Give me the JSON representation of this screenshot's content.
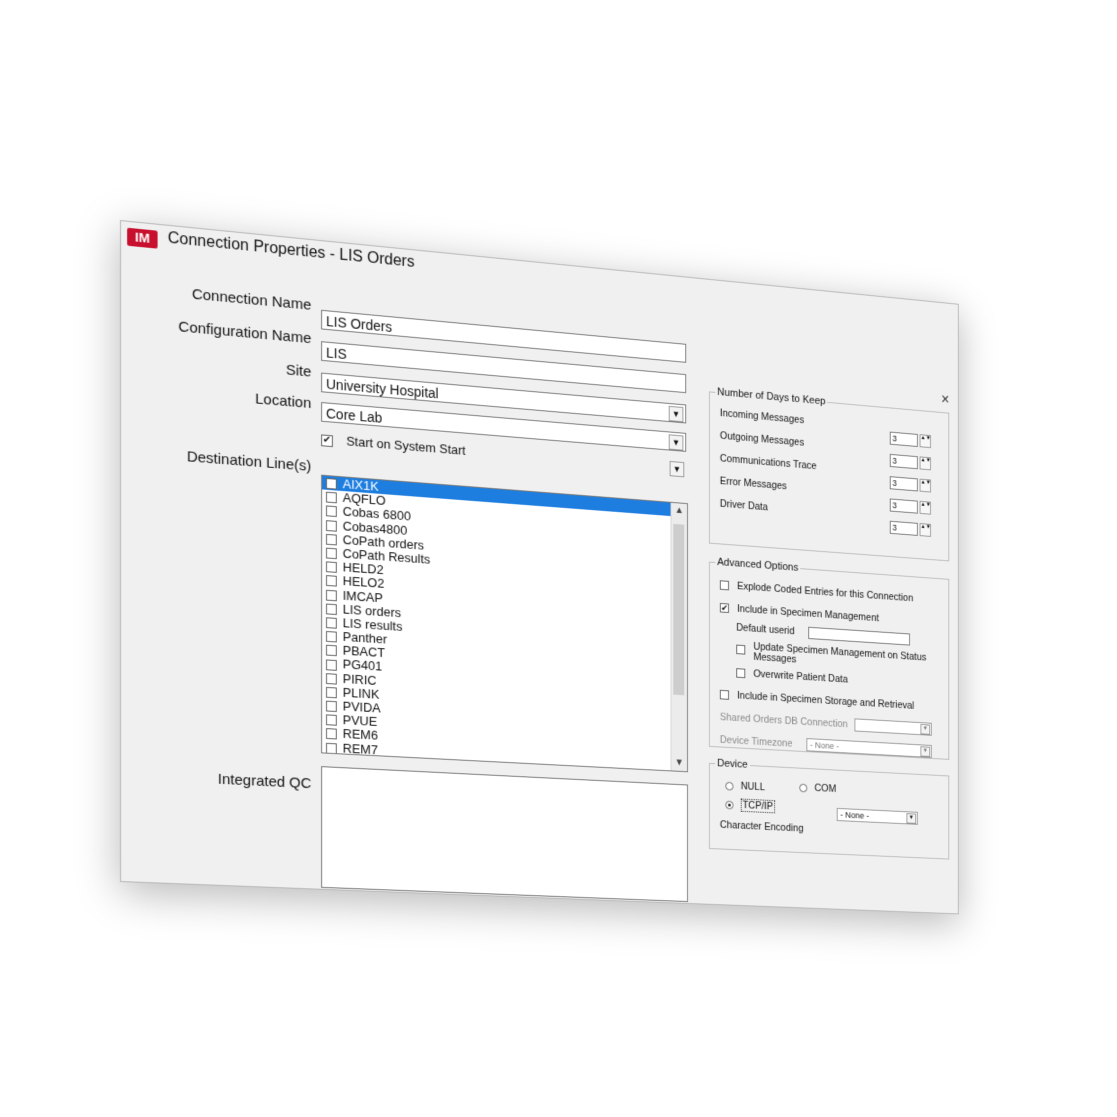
{
  "window": {
    "logo_text": "IM",
    "title": "Connection Properties - LIS Orders",
    "close_glyph": "×"
  },
  "form": {
    "connection_name_label": "Connection Name",
    "connection_name_value": "LIS Orders",
    "configuration_name_label": "Configuration Name",
    "configuration_name_value": "LIS",
    "site_label": "Site",
    "site_value": "University Hospital",
    "location_label": "Location",
    "location_value": "Core Lab",
    "start_on_system_start_label": "Start on System Start",
    "start_on_system_start_checked": true,
    "destination_lines_label": "Destination Line(s)",
    "destination_lines": [
      {
        "label": "AIX1K",
        "selected": true
      },
      {
        "label": "AQFLO",
        "selected": false
      },
      {
        "label": "Cobas 6800",
        "selected": false
      },
      {
        "label": "Cobas4800",
        "selected": false
      },
      {
        "label": "CoPath orders",
        "selected": false
      },
      {
        "label": "CoPath Results",
        "selected": false
      },
      {
        "label": "HELD2",
        "selected": false
      },
      {
        "label": "HELO2",
        "selected": false
      },
      {
        "label": "IMCAP",
        "selected": false
      },
      {
        "label": "LIS orders",
        "selected": false
      },
      {
        "label": "LIS results",
        "selected": false
      },
      {
        "label": "Panther",
        "selected": false
      },
      {
        "label": "PBACT",
        "selected": false
      },
      {
        "label": "PG401",
        "selected": false
      },
      {
        "label": "PIRIC",
        "selected": false
      },
      {
        "label": "PLINK",
        "selected": false
      },
      {
        "label": "PVIDA",
        "selected": false
      },
      {
        "label": "PVUE",
        "selected": false
      },
      {
        "label": "REM6",
        "selected": false
      },
      {
        "label": "REM7",
        "selected": false
      }
    ],
    "integrated_qc_label": "Integrated QC"
  },
  "days_to_keep": {
    "legend": "Number of Days to Keep",
    "rows": [
      {
        "label": "Incoming Messages",
        "value": "3"
      },
      {
        "label": "Outgoing Messages",
        "value": "3"
      },
      {
        "label": "Communications Trace",
        "value": "3"
      },
      {
        "label": "Error Messages",
        "value": "3"
      },
      {
        "label": "Driver Data",
        "value": "3"
      }
    ]
  },
  "advanced": {
    "legend": "Advanced Options",
    "explode_coded_label": "Explode Coded Entries for this Connection",
    "explode_coded_checked": false,
    "include_specimen_mgmt_label": "Include in Specimen Management",
    "include_specimen_mgmt_checked": true,
    "default_userid_label": "Default userid",
    "default_userid_value": "",
    "update_specimen_line1": "Update Specimen Management on Status",
    "update_specimen_line2": "Messages",
    "update_specimen_checked": false,
    "overwrite_patient_label": "Overwrite Patient Data",
    "overwrite_patient_checked": false,
    "include_storage_label": "Include in Specimen Storage and Retrieval",
    "include_storage_checked": false,
    "shared_orders_label": "Shared Orders DB Connection",
    "shared_orders_value": "",
    "device_timezone_label": "Device Timezone",
    "device_timezone_value": "- None -"
  },
  "device": {
    "legend": "Device",
    "null_label": "NULL",
    "com_label": "COM",
    "tcpip_label": "TCP/IP",
    "selected": "TCP/IP",
    "char_encoding_label": "Character Encoding",
    "char_encoding_value": "- None -"
  }
}
